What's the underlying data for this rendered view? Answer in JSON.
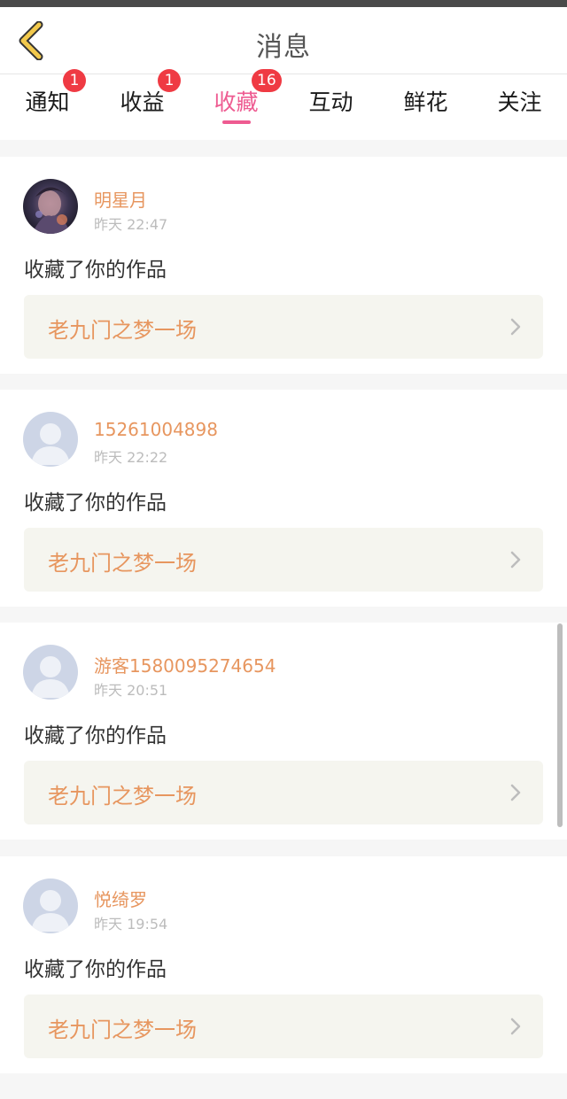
{
  "header": {
    "title": "消息"
  },
  "tabs": [
    {
      "label": "通知",
      "badge": "1",
      "active": false
    },
    {
      "label": "收益",
      "badge": "1",
      "active": false
    },
    {
      "label": "收藏",
      "badge": "16",
      "active": true
    },
    {
      "label": "互动",
      "badge": "",
      "active": false
    },
    {
      "label": "鲜花",
      "badge": "",
      "active": false
    },
    {
      "label": "关注",
      "badge": "",
      "active": false
    }
  ],
  "items": [
    {
      "user": "明星月",
      "time": "昨天 22:47",
      "action": "收藏了你的作品",
      "work": "老九门之梦一场",
      "avatar": "photo-avatar"
    },
    {
      "user": "15261004898",
      "time": "昨天 22:22",
      "action": "收藏了你的作品",
      "work": "老九门之梦一场",
      "avatar": "default-avatar"
    },
    {
      "user": "游客1580095274654",
      "time": "昨天 20:51",
      "action": "收藏了你的作品",
      "work": "老九门之梦一场",
      "avatar": "default-avatar"
    },
    {
      "user": "悦绮罗",
      "time": "昨天 19:54",
      "action": "收藏了你的作品",
      "work": "老九门之梦一场",
      "avatar": "default-avatar"
    }
  ],
  "colors": {
    "accent_pink": "#ee5b91",
    "name_orange": "#e7965f",
    "badge_red": "#ef3a43",
    "back_icon_yellow": "#f2c94c"
  }
}
